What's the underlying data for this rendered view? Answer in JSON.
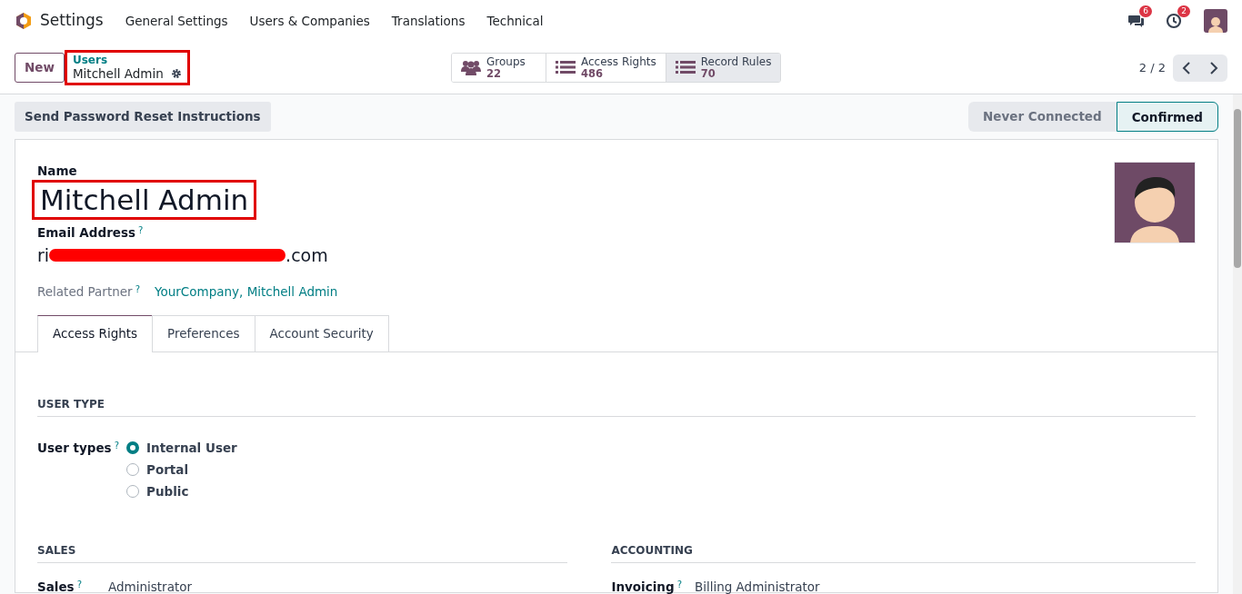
{
  "navbar": {
    "app": "Settings",
    "menus": [
      "General Settings",
      "Users & Companies",
      "Translations",
      "Technical"
    ],
    "messages_badge": "6",
    "activities_badge": "2"
  },
  "control_panel": {
    "new_button": "New",
    "breadcrumb": {
      "parent": "Users",
      "current": "Mitchell Admin",
      "highlighted": true
    },
    "smart_buttons": [
      {
        "label": "Groups",
        "value": "22",
        "kind": "groups",
        "hovered": false
      },
      {
        "label": "Access Rights",
        "value": "486",
        "kind": "list",
        "hovered": false
      },
      {
        "label": "Record Rules",
        "value": "70",
        "kind": "list",
        "hovered": true
      }
    ],
    "pager": "2 / 2"
  },
  "header": {
    "action_button": "Send Password Reset Instructions",
    "stages": [
      {
        "label": "Never Connected",
        "selected": false
      },
      {
        "label": "Confirmed",
        "selected": true
      }
    ]
  },
  "form": {
    "name_label": "Name",
    "name": "Mitchell Admin",
    "name_highlighted": true,
    "email_label": "Email Address",
    "email_help": "?",
    "email": {
      "start": "ri",
      "end": ".com",
      "redacted": true
    },
    "partner_label": "Related Partner",
    "partner_help": "?",
    "partner": "YourCompany, Mitchell Admin"
  },
  "tabs": [
    {
      "label": "Access Rights",
      "selected": true
    },
    {
      "label": "Preferences",
      "selected": false
    },
    {
      "label": "Account Security",
      "selected": false
    }
  ],
  "user_type": {
    "title": "USER TYPE",
    "field_label": "User types",
    "help": "?",
    "options": [
      {
        "label": "Internal User",
        "selected": true
      },
      {
        "label": "Portal",
        "selected": false
      },
      {
        "label": "Public",
        "selected": false
      }
    ]
  },
  "groups": [
    {
      "title": "SALES",
      "fields": [
        {
          "label": "Sales",
          "help": "?",
          "value": "Administrator"
        }
      ]
    },
    {
      "title": "ACCOUNTING",
      "fields": [
        {
          "label": "Invoicing",
          "help": "?",
          "value": "Billing Administrator"
        }
      ]
    }
  ]
}
